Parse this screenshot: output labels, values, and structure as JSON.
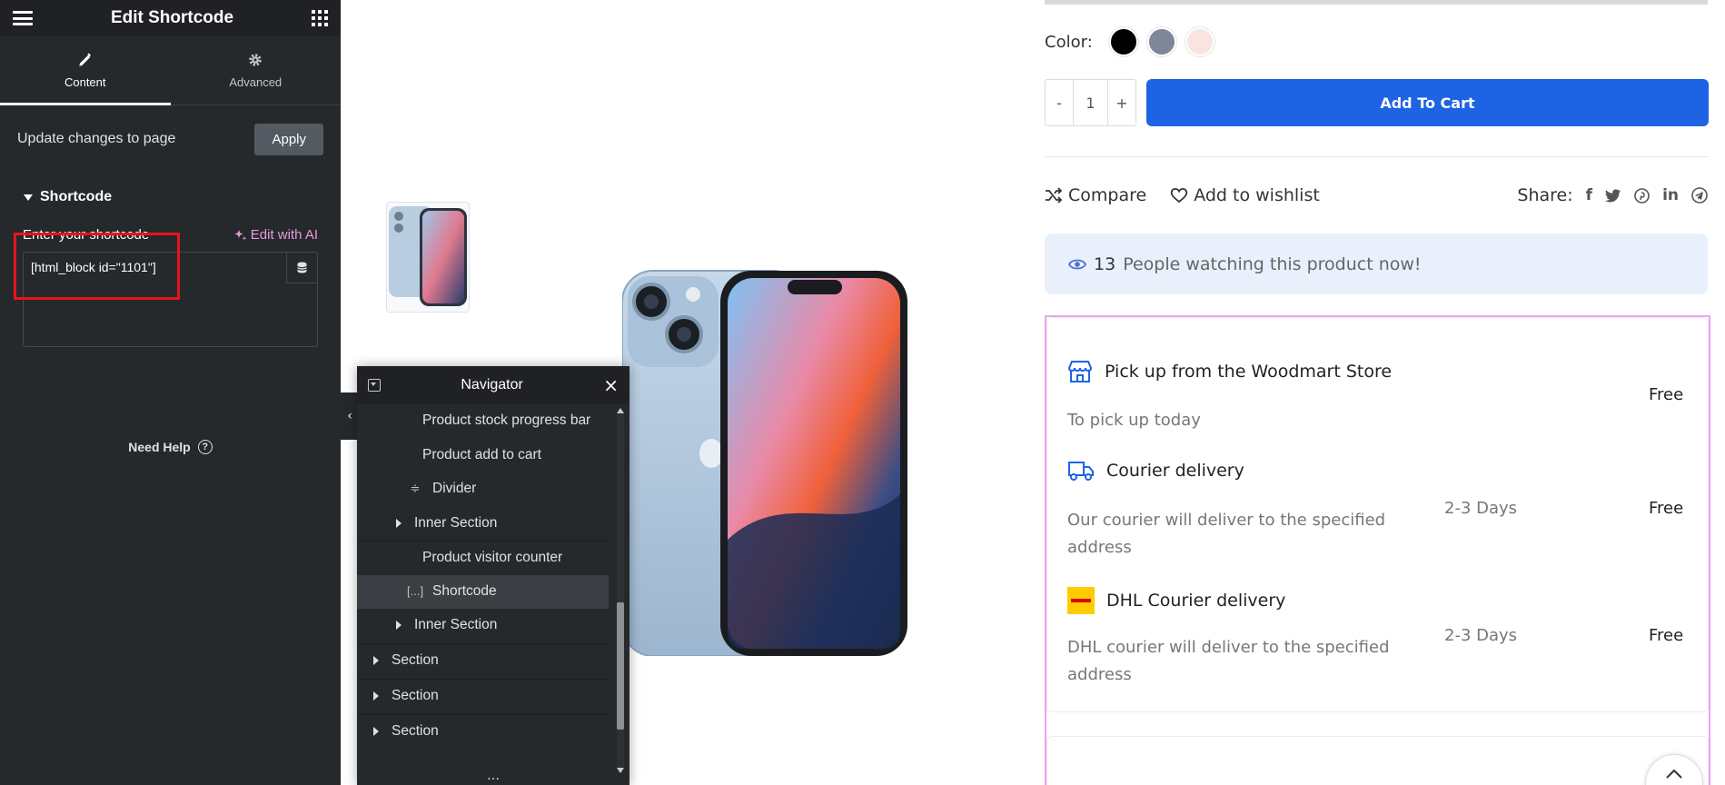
{
  "panel": {
    "title": "Edit Shortcode",
    "tabs": [
      {
        "label": "Content",
        "icon": "pencil-icon",
        "active": true
      },
      {
        "label": "Advanced",
        "icon": "gear-icon",
        "active": false
      }
    ],
    "update_text": "Update changes to page",
    "apply_label": "Apply",
    "section_title": "Shortcode",
    "shortcode_label": "Enter your shortcode",
    "edit_ai_label": "Edit with AI",
    "shortcode_value": "[html_block id=\"1101\"]",
    "need_help": "Need Help"
  },
  "navigator": {
    "title": "Navigator",
    "items": [
      {
        "label": "Product stock progress bar",
        "type": "widget"
      },
      {
        "label": "Product add to cart",
        "type": "widget"
      },
      {
        "label": "Divider",
        "type": "divider"
      },
      {
        "label": "Inner Section",
        "type": "inner-section"
      },
      {
        "label": "Product visitor counter",
        "type": "widget"
      },
      {
        "label": "Shortcode",
        "type": "shortcode",
        "icon_text": "[...]",
        "selected": true
      },
      {
        "label": "Inner Section",
        "type": "inner-section"
      },
      {
        "label": "Section",
        "type": "section"
      },
      {
        "label": "Section",
        "type": "section"
      },
      {
        "label": "Section",
        "type": "section"
      }
    ]
  },
  "product": {
    "color_label": "Color",
    "colors": [
      "#000000",
      "#7d8797",
      "#fbe4e0"
    ],
    "quantity": "1",
    "qty_minus": "-",
    "qty_plus": "+",
    "add_to_cart": "Add To Cart",
    "compare": "Compare",
    "wishlist": "Add to wishlist",
    "share": "Share:",
    "watching_count": "13",
    "watching_text": "People watching this product now!",
    "accent": "#1e63e3"
  },
  "delivery": {
    "pickup_title": "Pick up from the Woodmart Store",
    "pickup_desc": "To pick up today",
    "pickup_price": "Free",
    "courier_title": "Courier delivery",
    "courier_desc": "Our courier will deliver to the specified address",
    "courier_days": "2-3 Days",
    "courier_price": "Free",
    "dhl_title": "DHL Courier delivery",
    "dhl_desc": "DHL courier will deliver to the specified address",
    "dhl_days": "2-3 Days",
    "dhl_price": "Free"
  }
}
